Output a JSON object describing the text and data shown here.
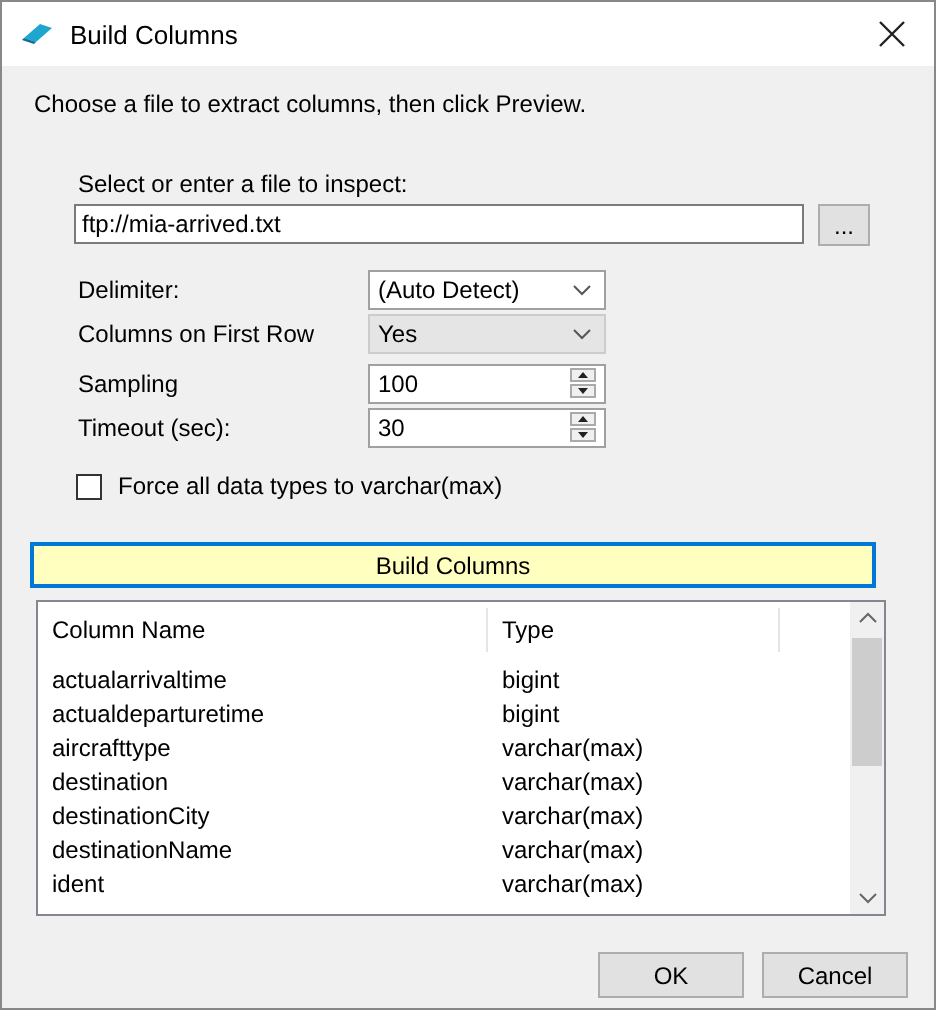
{
  "window": {
    "title": "Build Columns"
  },
  "instruction": "Choose a file to extract columns, then click Preview.",
  "file": {
    "label": "Select or enter a file to inspect:",
    "value": "ftp://mia-arrived.txt",
    "browse_button": "..."
  },
  "options": [
    {
      "kind": "dropdown",
      "label": "Delimiter:",
      "value": "(Auto Detect)",
      "editable": true
    },
    {
      "kind": "dropdown",
      "label": "Columns on First Row",
      "value": "Yes",
      "editable": false
    },
    {
      "kind": "spinner",
      "label": "Sampling",
      "value": "100"
    },
    {
      "kind": "spinner",
      "label": "Timeout (sec):",
      "value": "30"
    }
  ],
  "force_varchar": {
    "label": "Force all data types to varchar(max)",
    "checked": false
  },
  "build_button": "Build Columns",
  "table": {
    "columns": [
      "Column Name",
      "Type"
    ],
    "rows": [
      [
        "actualarrivaltime",
        "bigint"
      ],
      [
        "actualdeparturetime",
        "bigint"
      ],
      [
        "aircrafttype",
        "varchar(max)"
      ],
      [
        "destination",
        "varchar(max)"
      ],
      [
        "destinationCity",
        "varchar(max)"
      ],
      [
        "destinationName",
        "varchar(max)"
      ],
      [
        "ident",
        "varchar(max)"
      ]
    ]
  },
  "buttons": [
    "OK",
    "Cancel"
  ]
}
